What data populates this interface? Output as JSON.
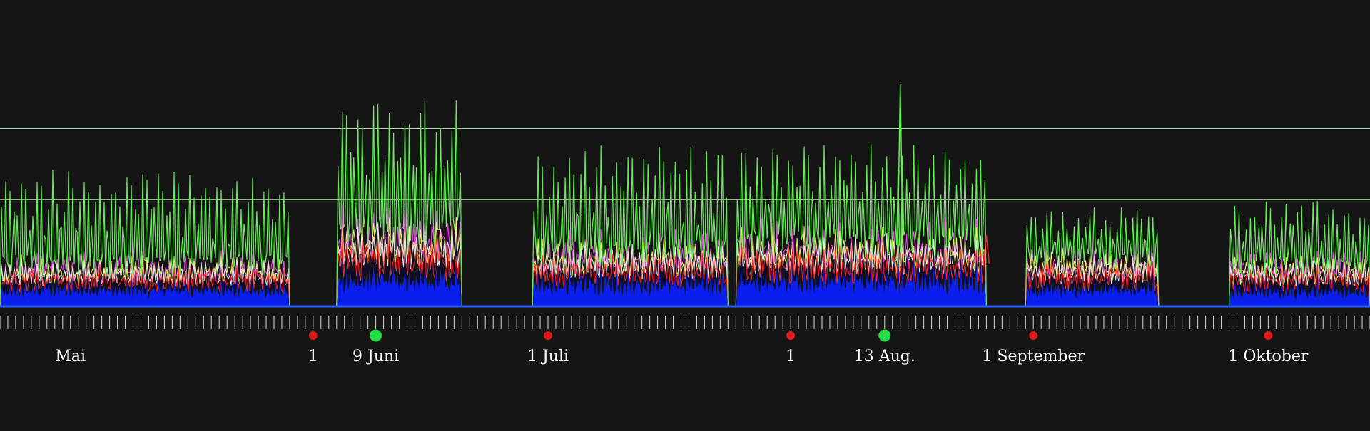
{
  "chart_data": {
    "type": "area",
    "title": "",
    "xlabel": "",
    "ylabel": "",
    "x_range": [
      "2018-04-22",
      "2018-10-14"
    ],
    "y_range": [
      0,
      100
    ],
    "grid": false,
    "reference_lines": [
      {
        "y": 80,
        "color": "#b8f0a8"
      },
      {
        "y": 48,
        "color": "#b8f0a8"
      }
    ],
    "colors": {
      "background": "#151515",
      "baseline": "#2a5cff",
      "area_fill": "#0a1ef0",
      "series_green": "#66ee55",
      "series_yellow": "#f0ee66",
      "series_magenta": "#ee44ee",
      "series_red": "#ff2222",
      "series_white": "#e8e8e8",
      "marker_red": "#e01818",
      "marker_green": "#22dd44",
      "text": "#ffffff"
    },
    "segments": [
      {
        "start": "2018-04-22",
        "end": "2018-05-29",
        "peak_level": 57,
        "mid_level": 18,
        "base_level": 9
      },
      {
        "start": "2018-06-04",
        "end": "2018-06-20",
        "peak_level": 88,
        "mid_level": 32,
        "base_level": 14
      },
      {
        "start": "2018-06-29",
        "end": "2018-07-24",
        "peak_level": 67,
        "mid_level": 24,
        "base_level": 12
      },
      {
        "start": "2018-07-25",
        "end": "2018-08-26",
        "peak_level": 70,
        "mid_level": 28,
        "base_level": 14
      },
      {
        "start": "2018-08-31",
        "end": "2018-09-17",
        "peak_level": 43,
        "mid_level": 20,
        "base_level": 9
      },
      {
        "start": "2018-09-26",
        "end": "2018-10-14",
        "peak_level": 45,
        "mid_level": 18,
        "base_level": 8
      }
    ],
    "spikes": [
      {
        "date": "2018-08-15",
        "y": 100
      },
      {
        "date": "2018-08-26",
        "y": 32,
        "color": "#ff2222"
      }
    ],
    "date_labels": [
      {
        "date": "2018-05-01",
        "text": "Mai"
      },
      {
        "date": "2018-06-01",
        "text": "1"
      },
      {
        "date": "2018-06-09",
        "text": "9 Juni"
      },
      {
        "date": "2018-07-01",
        "text": "1 Juli"
      },
      {
        "date": "2018-08-01",
        "text": "1"
      },
      {
        "date": "2018-08-13",
        "text": "13 Aug."
      },
      {
        "date": "2018-09-01",
        "text": "1 September"
      },
      {
        "date": "2018-10-01",
        "text": "1 Oktober"
      }
    ],
    "markers": [
      {
        "date": "2018-06-01",
        "color": "red"
      },
      {
        "date": "2018-06-09",
        "color": "green"
      },
      {
        "date": "2018-07-01",
        "color": "red"
      },
      {
        "date": "2018-08-01",
        "color": "red"
      },
      {
        "date": "2018-08-13",
        "color": "green"
      },
      {
        "date": "2018-09-01",
        "color": "red"
      },
      {
        "date": "2018-10-01",
        "color": "red"
      }
    ]
  }
}
